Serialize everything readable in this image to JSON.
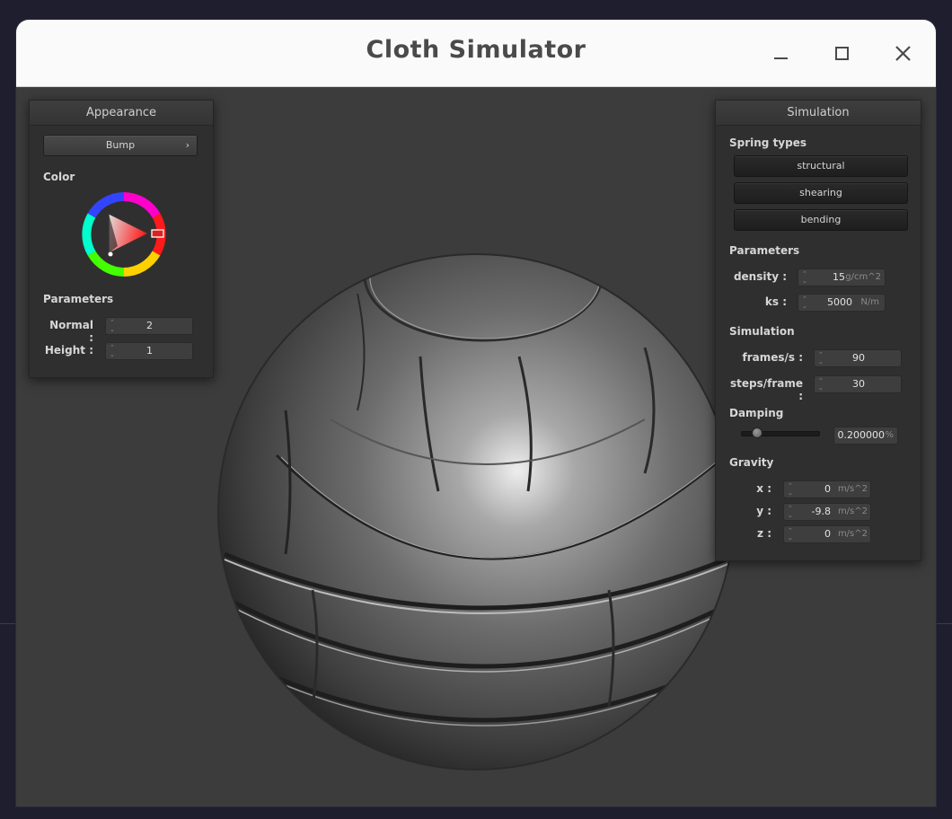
{
  "window": {
    "title": "Cloth Simulator"
  },
  "appearance": {
    "header": "Appearance",
    "shader_select": "Bump",
    "color_label": "Color",
    "params_label": "Parameters",
    "normal_label": "Normal :",
    "normal_value": "2",
    "height_label": "Height :",
    "height_value": "1"
  },
  "simulation": {
    "header": "Simulation",
    "spring_types_label": "Spring types",
    "spring_buttons": [
      "structural",
      "shearing",
      "bending"
    ],
    "params_label": "Parameters",
    "density_label": "density :",
    "density_value": "15",
    "density_unit": "g/cm^2",
    "ks_label": "ks :",
    "ks_value": "5000",
    "ks_unit": "N/m",
    "sim_label": "Simulation",
    "fps_label": "frames/s :",
    "fps_value": "90",
    "steps_label": "steps/frame :",
    "steps_value": "30",
    "damping_label": "Damping",
    "damping_value": "0.200000",
    "damping_unit": "%",
    "damping_slider_fraction": 0.2,
    "gravity_label": "Gravity",
    "gx_label": "x :",
    "gx_value": "0",
    "gy_label": "y :",
    "gy_value": "-9.8",
    "gz_label": "z :",
    "gz_value": "0",
    "gravity_unit": "m/s^2"
  },
  "icons": [
    "minimize-icon",
    "maximize-icon",
    "close-icon",
    "chevron-right-icon",
    "color-wheel-icon"
  ]
}
